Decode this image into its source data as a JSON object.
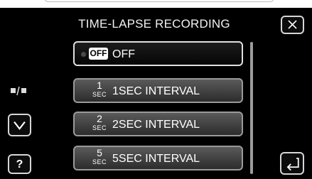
{
  "header": {
    "title": "TIME-LAPSE RECORDING"
  },
  "menu": {
    "items": [
      {
        "icon_text": "OFF",
        "label": "OFF",
        "selected": true
      },
      {
        "icon_num": "1",
        "icon_unit": "SEC",
        "label": "1SEC INTERVAL"
      },
      {
        "icon_num": "2",
        "icon_unit": "SEC",
        "label": "2SEC INTERVAL"
      },
      {
        "icon_num": "5",
        "icon_unit": "SEC",
        "label": "5SEC INTERVAL"
      }
    ]
  },
  "controls": {
    "help_label": "?"
  },
  "icons": {
    "close": "close-icon",
    "page_indicator": "page-indicator-icon",
    "down": "chevron-down-icon",
    "back": "back-arrow-icon"
  }
}
